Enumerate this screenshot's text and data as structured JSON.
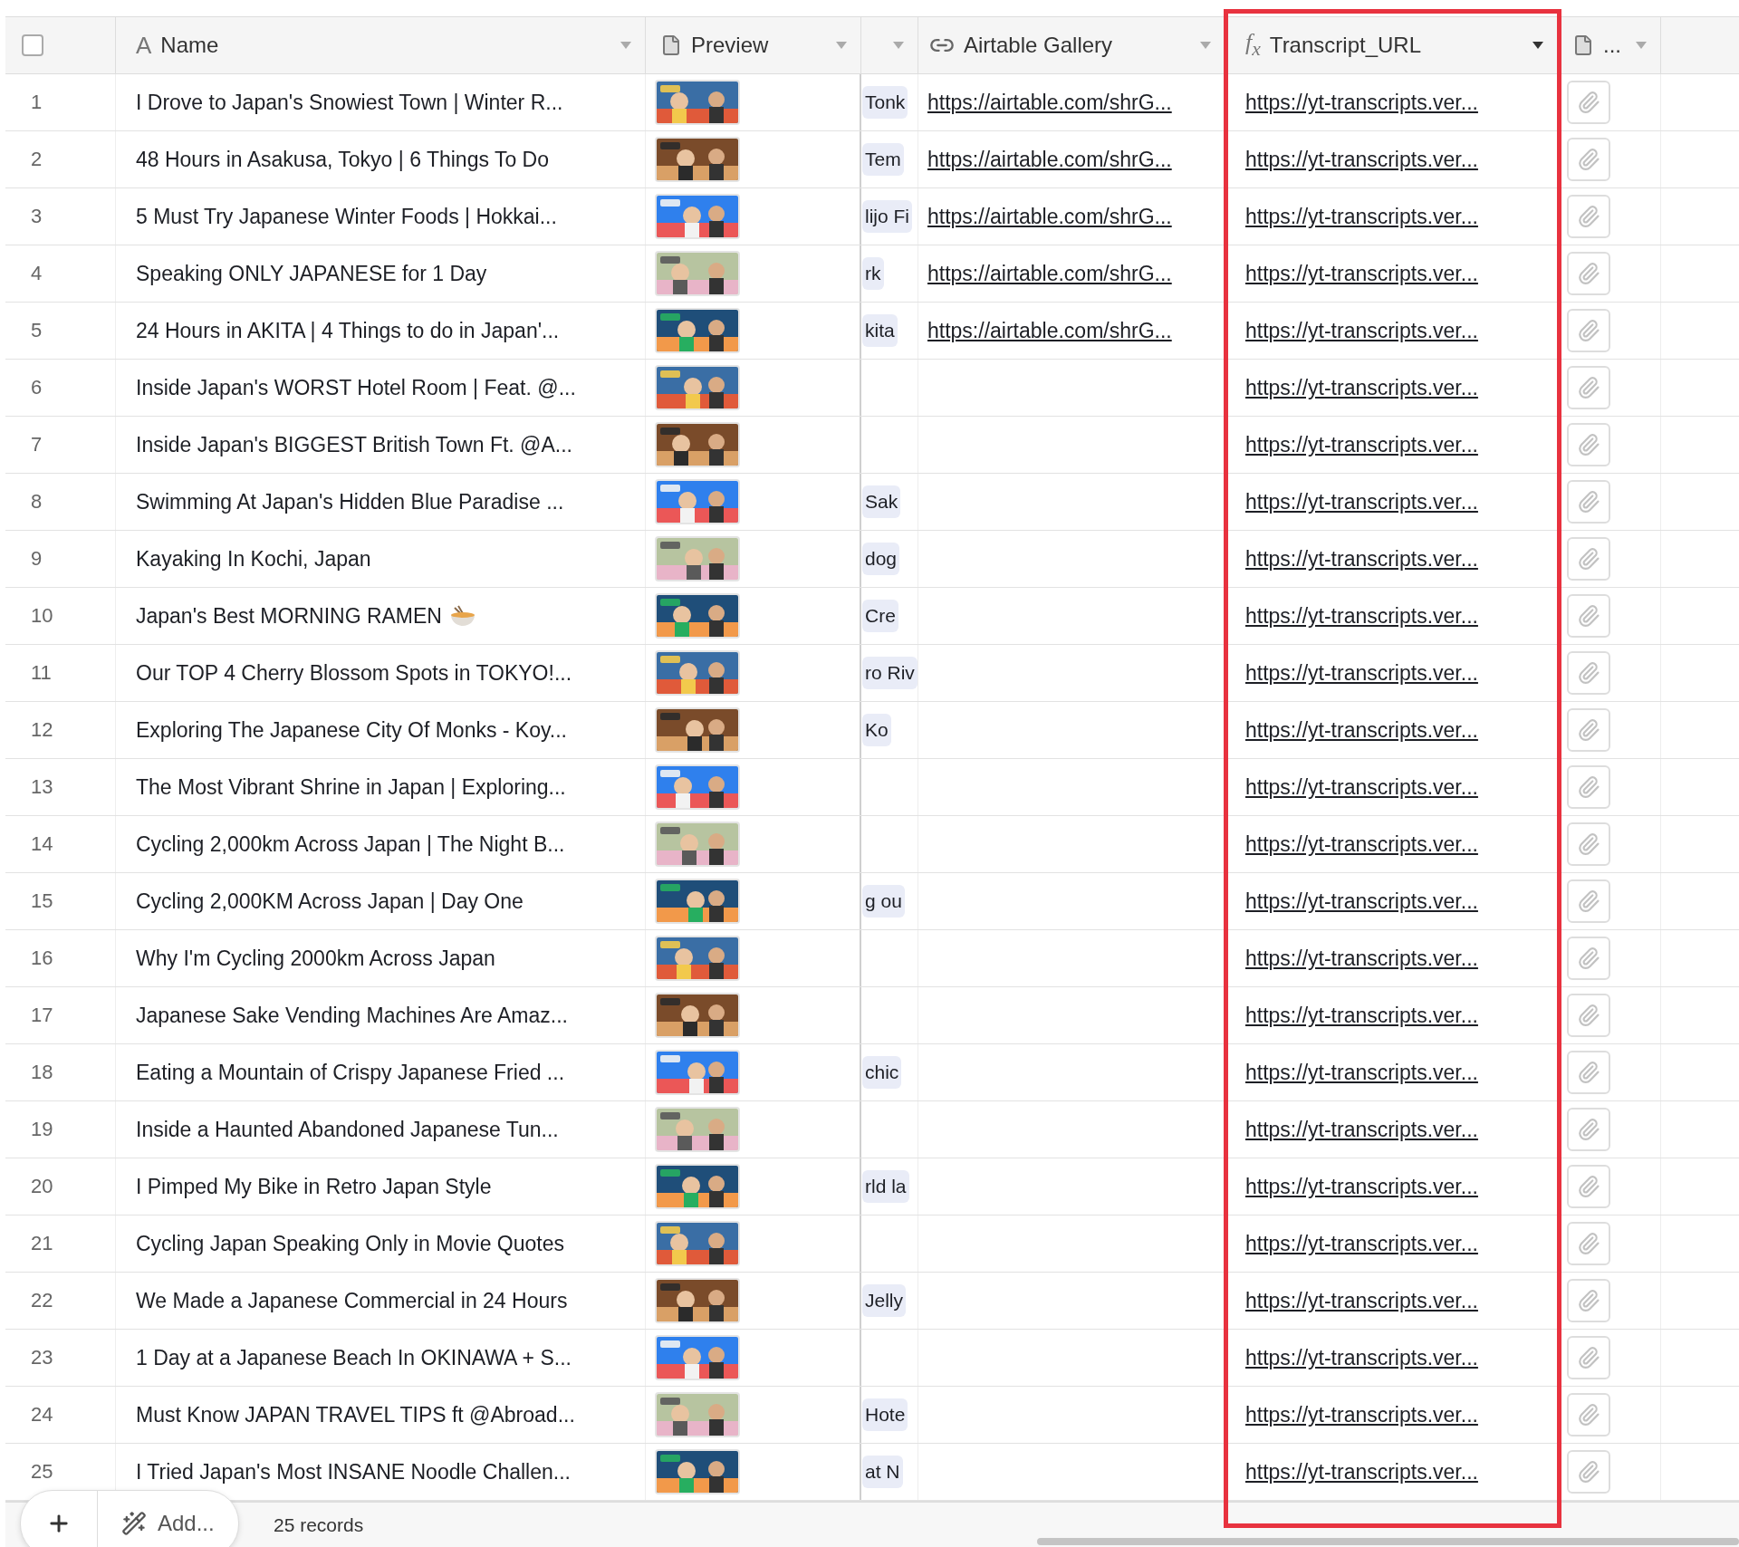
{
  "table": {
    "columns": [
      {
        "kind": "select",
        "checked": false
      },
      {
        "kind": "text",
        "type_glyph": "A",
        "label": "Name"
      },
      {
        "kind": "file",
        "label": "Preview"
      },
      {
        "kind": "hidden"
      },
      {
        "kind": "link",
        "label": "Airtable Gallery"
      },
      {
        "kind": "formula",
        "type_glyph": "f$_{x}$",
        "label": "Transcript_URL",
        "highlighted": true
      },
      {
        "kind": "file",
        "label": "..."
      }
    ],
    "rows": [
      {
        "number": "1",
        "name": "I Drove to Japan's Snowiest Town | Winter R...",
        "chips": [
          "Tonk"
        ],
        "gallery": "https://airtable.com/shrG...",
        "transcript": "https://yt-transcripts.ver..."
      },
      {
        "number": "2",
        "name": "48 Hours in Asakusa, Tokyo | 6 Things To Do",
        "chips": [
          "Tem"
        ],
        "gallery": "https://airtable.com/shrG...",
        "transcript": "https://yt-transcripts.ver..."
      },
      {
        "number": "3",
        "name": "5 Must Try Japanese Winter Foods | Hokkai...",
        "chips": [
          "lijo Fi"
        ],
        "gallery": "https://airtable.com/shrG...",
        "transcript": "https://yt-transcripts.ver..."
      },
      {
        "number": "4",
        "name": "Speaking ONLY JAPANESE for 1 Day",
        "chips": [
          "rk"
        ],
        "gallery": "https://airtable.com/shrG...",
        "transcript": "https://yt-transcripts.ver..."
      },
      {
        "number": "5",
        "name": "24 Hours in AKITA | 4 Things to do in Japan'...",
        "chips": [
          "kita"
        ],
        "gallery": "https://airtable.com/shrG...",
        "transcript": "https://yt-transcripts.ver..."
      },
      {
        "number": "6",
        "name": "Inside Japan's WORST Hotel Room | Feat. @...",
        "transcript": "https://yt-transcripts.ver..."
      },
      {
        "number": "7",
        "name": "Inside Japan's BIGGEST British Town Ft. @A...",
        "transcript": "https://yt-transcripts.ver..."
      },
      {
        "number": "8",
        "name": "Swimming At Japan's Hidden Blue Paradise ...",
        "chips": [
          "Sak"
        ],
        "transcript": "https://yt-transcripts.ver..."
      },
      {
        "number": "9",
        "name": "Kayaking In Kochi, Japan",
        "chips": [
          "dog"
        ],
        "transcript": "https://yt-transcripts.ver..."
      },
      {
        "number": "10",
        "name": "Japan's Best MORNING RAMEN",
        "emoji": true,
        "chips": [
          "Cre"
        ],
        "transcript": "https://yt-transcripts.ver..."
      },
      {
        "number": "11",
        "name": "Our TOP 4 Cherry Blossom Spots in TOKYO!...",
        "chips": [
          "ro Riv"
        ],
        "transcript": "https://yt-transcripts.ver..."
      },
      {
        "number": "12",
        "name": "Exploring The Japanese City Of Monks - Koy...",
        "chips": [
          "Ko"
        ],
        "transcript": "https://yt-transcripts.ver..."
      },
      {
        "number": "13",
        "name": "The Most Vibrant Shrine in Japan | Exploring...",
        "transcript": "https://yt-transcripts.ver..."
      },
      {
        "number": "14",
        "name": "Cycling 2,000km Across Japan | The Night B...",
        "transcript": "https://yt-transcripts.ver..."
      },
      {
        "number": "15",
        "name": "Cycling 2,000KM Across Japan | Day One",
        "chips": [
          "g ou"
        ],
        "transcript": "https://yt-transcripts.ver..."
      },
      {
        "number": "16",
        "name": "Why I'm Cycling 2000km Across Japan",
        "transcript": "https://yt-transcripts.ver..."
      },
      {
        "number": "17",
        "name": "Japanese Sake Vending Machines Are Amaz...",
        "transcript": "https://yt-transcripts.ver..."
      },
      {
        "number": "18",
        "name": "Eating a Mountain of Crispy Japanese Fried ...",
        "chips": [
          "chic"
        ],
        "transcript": "https://yt-transcripts.ver..."
      },
      {
        "number": "19",
        "name": "Inside a Haunted Abandoned Japanese Tun...",
        "transcript": "https://yt-transcripts.ver..."
      },
      {
        "number": "20",
        "name": "I Pimped My Bike in Retro Japan Style",
        "chips": [
          "rld la"
        ],
        "transcript": "https://yt-transcripts.ver..."
      },
      {
        "number": "21",
        "name": "Cycling Japan Speaking Only in Movie Quotes",
        "transcript": "https://yt-transcripts.ver..."
      },
      {
        "number": "22",
        "name": "We Made a Japanese Commercial in 24 Hours",
        "chips": [
          "Jelly"
        ],
        "transcript": "https://yt-transcripts.ver..."
      },
      {
        "number": "23",
        "name": "1 Day at a Japanese Beach In OKINAWA + S...",
        "transcript": "https://yt-transcripts.ver..."
      },
      {
        "number": "24",
        "name": "Must Know JAPAN TRAVEL TIPS ft @Abroad...",
        "chips": [
          "Hote"
        ],
        "transcript": "https://yt-transcripts.ver..."
      },
      {
        "number": "25",
        "name": "I Tried Japan's Most INSANE Noodle Challen...",
        "chips": [
          "at N"
        ],
        "transcript": "https://yt-transcripts.ver..."
      }
    ]
  },
  "footer": {
    "add_label": "Add...",
    "record_count": "25 records"
  }
}
